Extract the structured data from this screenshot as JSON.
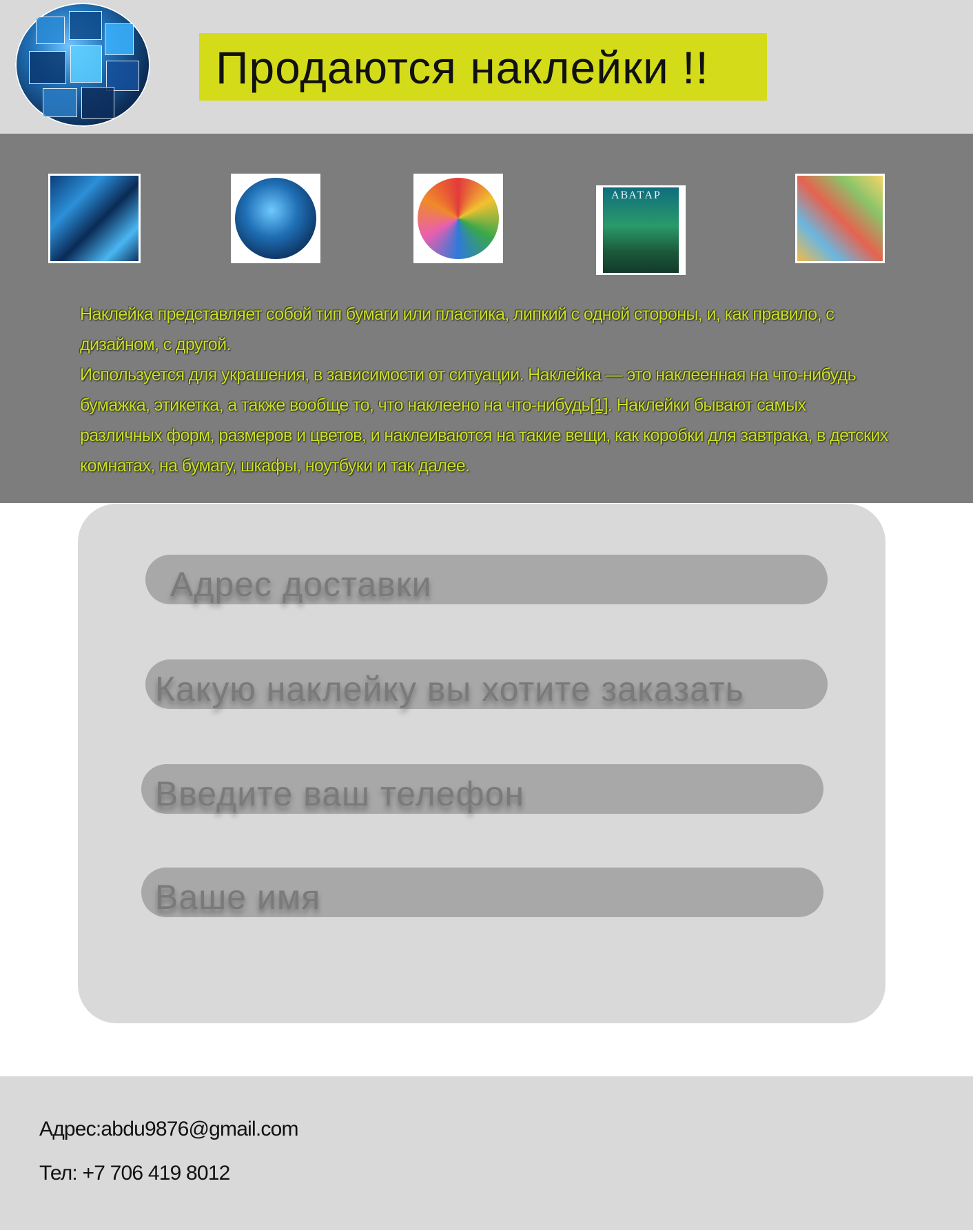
{
  "header": {
    "logo": {
      "icon": "avatar-sticker-pack-logo",
      "alt": ""
    },
    "title": "Продаются наклейки !!",
    "title_bg": "#d4dc1a"
  },
  "gallery": {
    "background": "#7d7d7d",
    "thumbnails": [
      {
        "icon": "avatar-stickers-square"
      },
      {
        "icon": "avatar-stickers-round"
      },
      {
        "icon": "colorful-stickers-round"
      },
      {
        "icon": "avatar-movie-poster",
        "poster_title": "АВАТАР"
      },
      {
        "icon": "cartoon-stickers-square"
      }
    ],
    "description": {
      "line1": "Наклейка представляет собой тип бумаги или пластика, липкий с одной стороны, и, как правило, с",
      "line2": "дизайном, с другой.",
      "line3": "Используется для украшения, в зависимости от ситуации. Наклейка — это наклеенная на что-нибудь",
      "line4_before": "бумажка, этикетка, а также вообще то, что наклеено на что-нибудь",
      "line4_ref": "[1]",
      "line4_after": ". Наклейки бывают самых",
      "line5": "различных форм, размеров и цветов, и наклеиваются на такие вещи, как коробки для завтрака, в детских",
      "line6": "комнатах, на бумагу, шкафы, ноутбуки и так далее.",
      "text_color": "#c9e02a"
    }
  },
  "form": {
    "fields": [
      {
        "placeholder": "Адрес доставки"
      },
      {
        "placeholder": "Какую наклейку вы хотите заказать"
      },
      {
        "placeholder": "Введите ваш телефон"
      },
      {
        "placeholder": "Ваше имя"
      }
    ]
  },
  "footer": {
    "address": "Адрес:abdu9876@gmail.com",
    "phone": "Тел: +7 706 419 8012"
  }
}
